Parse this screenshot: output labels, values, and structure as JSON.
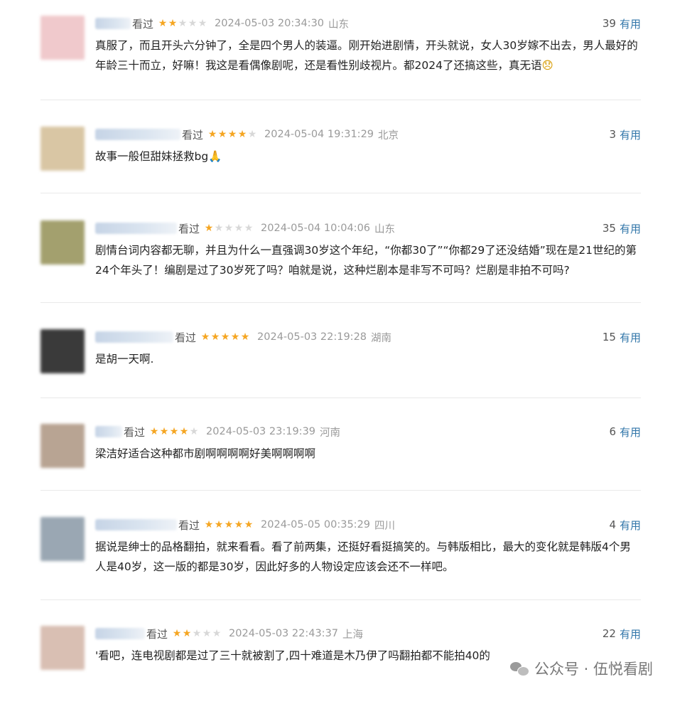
{
  "comments": [
    {
      "watched": "看过",
      "rating": 2,
      "time": "2024-05-03 20:34:30",
      "location": "山东",
      "votes": "39",
      "useful": "有用",
      "text": "真服了，而且开头六分钟了，全是四个男人的装逼。刚开始进剧情，开头就说，女人30岁嫁不出去，男人最好的年龄三十而立，好嘛！我这是看偶像剧呢，还是看性别歧视片。都2024了还搞这些，真无语",
      "emoji": "😞",
      "avatar_color": "#f0c9cc"
    },
    {
      "watched": "看过",
      "rating": 4,
      "time": "2024-05-04 19:31:29",
      "location": "北京",
      "votes": "3",
      "useful": "有用",
      "text": "故事一般但甜妹拯救bg",
      "emoji": "🙏",
      "avatar_color": "#d9c6a4"
    },
    {
      "watched": "看过",
      "rating": 1,
      "time": "2024-05-04 10:04:06",
      "location": "山东",
      "votes": "35",
      "useful": "有用",
      "text": "剧情台词内容都无聊，并且为什么一直强调30岁这个年纪，“你都30了”“你都29了还没结婚”现在是21世纪的第24个年头了！编剧是过了30岁死了吗？咱就是说，这种烂剧本是非写不可吗？烂剧是非拍不可吗?",
      "emoji": "",
      "avatar_color": "#a3a06e"
    },
    {
      "watched": "看过",
      "rating": 5,
      "time": "2024-05-03 22:19:28",
      "location": "湖南",
      "votes": "15",
      "useful": "有用",
      "text": "是胡一天啊.",
      "emoji": "",
      "avatar_color": "#3a3a3a"
    },
    {
      "watched": "看过",
      "rating": 4,
      "time": "2024-05-03 23:19:39",
      "location": "河南",
      "votes": "6",
      "useful": "有用",
      "text": "梁洁好适合这种都市剧啊啊啊啊好美啊啊啊啊",
      "emoji": "",
      "avatar_color": "#b8a493"
    },
    {
      "watched": "看过",
      "rating": 5,
      "time": "2024-05-05 00:35:29",
      "location": "四川",
      "votes": "4",
      "useful": "有用",
      "text": "据说是绅士的品格翻拍，就来看看。看了前两集，还挺好看挺搞笑的。与韩版相比，最大的变化就是韩版4个男人是40岁，这一版的都是30岁，因此好多的人物设定应该会还不一样吧。",
      "emoji": "",
      "avatar_color": "#9aa7b3"
    },
    {
      "watched": "看过",
      "rating": 2,
      "time": "2024-05-03 22:43:37",
      "location": "上海",
      "votes": "22",
      "useful": "有用",
      "text": "'看吧，连电视剧都是过了三十就被割了,四十难道是木乃伊了吗翻拍都不能拍40的",
      "emoji": "",
      "avatar_color": "#d9bfb3"
    }
  ],
  "watermark": {
    "text": "公众号 · 伍悦看剧",
    "icon": "wechat-icon"
  }
}
